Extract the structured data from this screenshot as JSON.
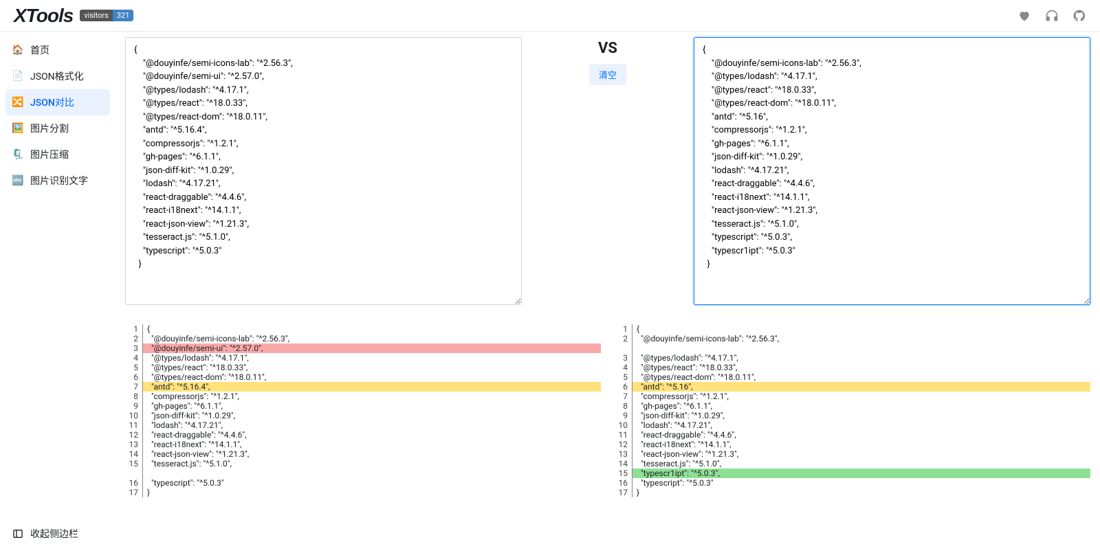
{
  "header": {
    "logo": "XTools",
    "visitors_label": "visitors",
    "visitors_count": "321"
  },
  "sidebar": {
    "items": [
      {
        "icon": "🏠",
        "label": "首页"
      },
      {
        "icon": "📄",
        "label": "JSON格式化"
      },
      {
        "icon": "🔀",
        "label": "JSON对比",
        "active": true
      },
      {
        "icon": "🖼️",
        "label": "图片分割"
      },
      {
        "icon": "🗜️",
        "label": "图片压缩"
      },
      {
        "icon": "🔤",
        "label": "图片识别文字"
      }
    ],
    "collapse_label": "收起侧边栏"
  },
  "compare": {
    "vs_label": "VS",
    "clear_label": "清空",
    "left_text": "{\n    \"@douyinfe/semi-icons-lab\": \"^2.56.3\",\n    \"@douyinfe/semi-ui\": \"^2.57.0\",\n    \"@types/lodash\": \"^4.17.1\",\n    \"@types/react\": \"^18.0.33\",\n    \"@types/react-dom\": \"^18.0.11\",\n    \"antd\": \"^5.16.4\",\n    \"compressorjs\": \"^1.2.1\",\n    \"gh-pages\": \"^6.1.1\",\n    \"json-diff-kit\": \"^1.0.29\",\n    \"lodash\": \"^4.17.21\",\n    \"react-draggable\": \"^4.4.6\",\n    \"react-i18next\": \"^14.1.1\",\n    \"react-json-view\": \"^1.21.3\",\n    \"tesseract.js\": \"^5.1.0\",\n    \"typescript\": \"^5.0.3\"\n  }",
    "right_text": "{\n    \"@douyinfe/semi-icons-lab\": \"^2.56.3\",\n    \"@types/lodash\": \"^4.17.1\",\n    \"@types/react\": \"^18.0.33\",\n    \"@types/react-dom\": \"^18.0.11\",\n    \"antd\": \"^5.16\",\n    \"compressorjs\": \"^1.2.1\",\n    \"gh-pages\": \"^6.1.1\",\n    \"json-diff-kit\": \"^1.0.29\",\n    \"lodash\": \"^4.17.21\",\n    \"react-draggable\": \"^4.4.6\",\n    \"react-i18next\": \"^14.1.1\",\n    \"react-json-view\": \"^1.21.3\",\n    \"tesseract.js\": \"^5.1.0\",\n    \"typescript\": \"^5.0.3\",\n    \"typescr1ipt\": \"^5.0.3\"\n  }"
  },
  "diff": {
    "left": [
      {
        "n": 1,
        "text": "{",
        "type": ""
      },
      {
        "n": 2,
        "text": "  \"@douyinfe/semi-icons-lab\": \"^2.56.3\",",
        "type": ""
      },
      {
        "n": 3,
        "text": "  \"@douyinfe/semi-ui\": \"^2.57.0\",",
        "type": "removed"
      },
      {
        "n": 4,
        "text": "  \"@types/lodash\": \"^4.17.1\",",
        "type": ""
      },
      {
        "n": 5,
        "text": "  \"@types/react\": \"^18.0.33\",",
        "type": ""
      },
      {
        "n": 6,
        "text": "  \"@types/react-dom\": \"^18.0.11\",",
        "type": ""
      },
      {
        "n": 7,
        "text": "  \"antd\": \"^5.16.4\",",
        "type": "modified"
      },
      {
        "n": 8,
        "text": "  \"compressorjs\": \"^1.2.1\",",
        "type": ""
      },
      {
        "n": 9,
        "text": "  \"gh-pages\": \"^6.1.1\",",
        "type": ""
      },
      {
        "n": 10,
        "text": "  \"json-diff-kit\": \"^1.0.29\",",
        "type": ""
      },
      {
        "n": 11,
        "text": "  \"lodash\": \"^4.17.21\",",
        "type": ""
      },
      {
        "n": 12,
        "text": "  \"react-draggable\": \"^4.4.6\",",
        "type": ""
      },
      {
        "n": 13,
        "text": "  \"react-i18next\": \"^14.1.1\",",
        "type": ""
      },
      {
        "n": 14,
        "text": "  \"react-json-view\": \"^1.21.3\",",
        "type": ""
      },
      {
        "n": 15,
        "text": "  \"tesseract.js\": \"^5.1.0\",",
        "type": ""
      },
      {
        "n": "",
        "text": "",
        "type": "blank"
      },
      {
        "n": 16,
        "text": "  \"typescript\": \"^5.0.3\"",
        "type": ""
      },
      {
        "n": 17,
        "text": "}",
        "type": ""
      }
    ],
    "right": [
      {
        "n": 1,
        "text": "{",
        "type": ""
      },
      {
        "n": 2,
        "text": "  \"@douyinfe/semi-icons-lab\": \"^2.56.3\",",
        "type": ""
      },
      {
        "n": "",
        "text": "",
        "type": "blank"
      },
      {
        "n": 3,
        "text": "  \"@types/lodash\": \"^4.17.1\",",
        "type": ""
      },
      {
        "n": 4,
        "text": "  \"@types/react\": \"^18.0.33\",",
        "type": ""
      },
      {
        "n": 5,
        "text": "  \"@types/react-dom\": \"^18.0.11\",",
        "type": ""
      },
      {
        "n": 6,
        "text": "  \"antd\": \"^5.16\",",
        "type": "modified"
      },
      {
        "n": 7,
        "text": "  \"compressorjs\": \"^1.2.1\",",
        "type": ""
      },
      {
        "n": 8,
        "text": "  \"gh-pages\": \"^6.1.1\",",
        "type": ""
      },
      {
        "n": 9,
        "text": "  \"json-diff-kit\": \"^1.0.29\",",
        "type": ""
      },
      {
        "n": 10,
        "text": "  \"lodash\": \"^4.17.21\",",
        "type": ""
      },
      {
        "n": 11,
        "text": "  \"react-draggable\": \"^4.4.6\",",
        "type": ""
      },
      {
        "n": 12,
        "text": "  \"react-i18next\": \"^14.1.1\",",
        "type": ""
      },
      {
        "n": 13,
        "text": "  \"react-json-view\": \"^1.21.3\",",
        "type": ""
      },
      {
        "n": 14,
        "text": "  \"tesseract.js\": \"^5.1.0\",",
        "type": ""
      },
      {
        "n": 15,
        "text": "  \"typescr1ipt\": \"^5.0.3\",",
        "type": "added"
      },
      {
        "n": 16,
        "text": "  \"typescript\": \"^5.0.3\"",
        "type": ""
      },
      {
        "n": 17,
        "text": "}",
        "type": ""
      }
    ]
  }
}
